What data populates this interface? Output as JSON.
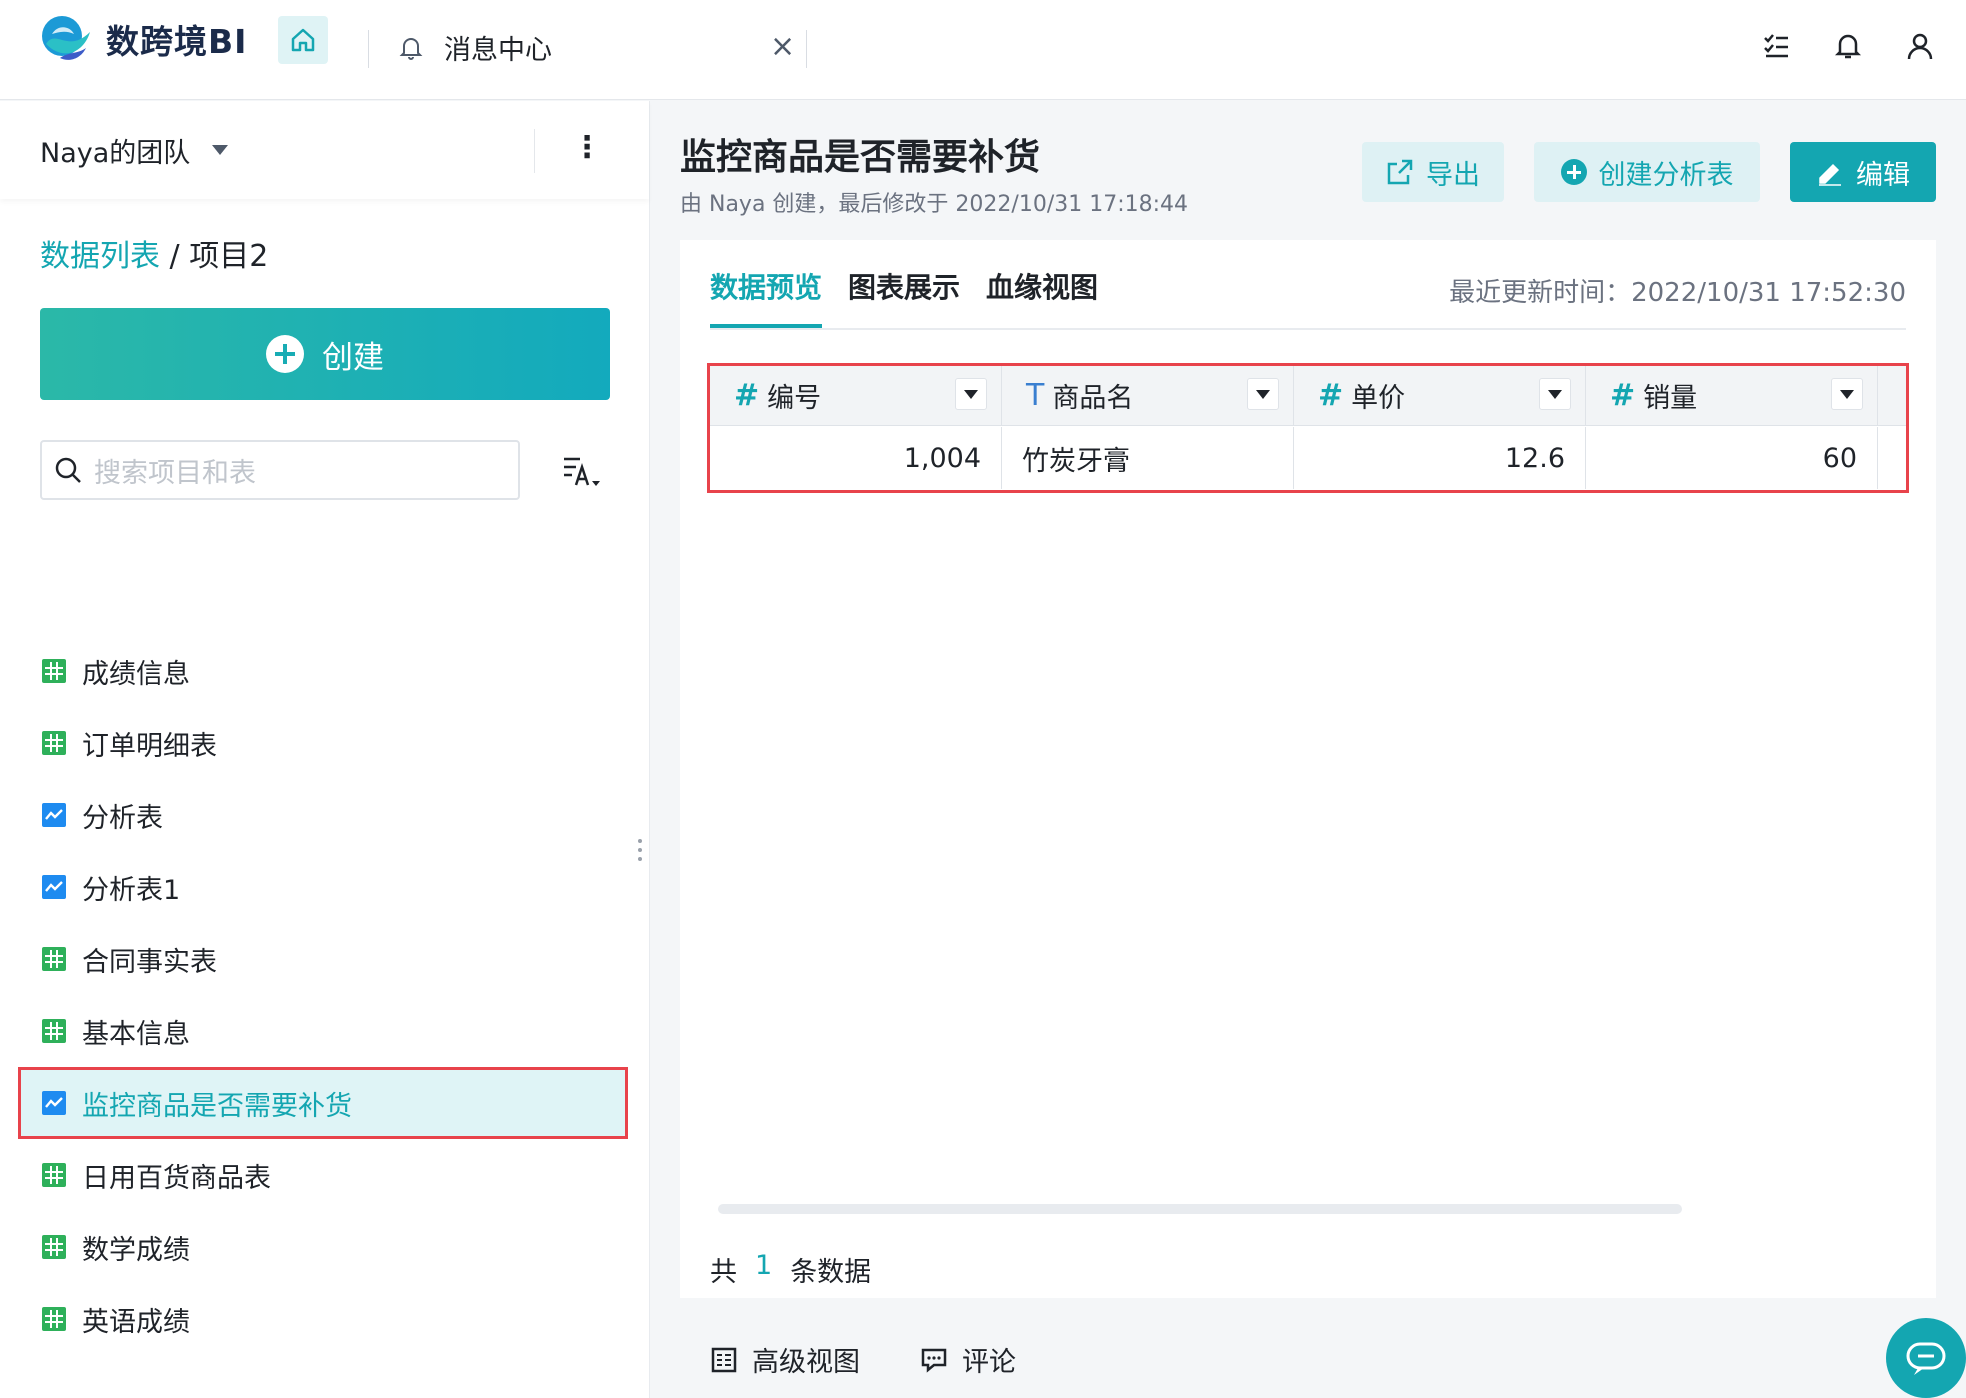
{
  "brand": {
    "name": "数跨境BI"
  },
  "top_tabs": {
    "message_tab": "消息中心",
    "close": "×"
  },
  "top_icons": [
    "tasks-icon",
    "bell-icon",
    "user-icon"
  ],
  "sidebar": {
    "team": "Naya的团队",
    "breadcrumb": {
      "link": "数据列表",
      "separator": "/",
      "current": "项目2"
    },
    "create_label": "创建",
    "search_placeholder": "搜索项目和表",
    "items": [
      {
        "label": "成绩信息",
        "icon": "table-icon"
      },
      {
        "label": "订单明细表",
        "icon": "table-icon"
      },
      {
        "label": "分析表",
        "icon": "chart-icon"
      },
      {
        "label": "分析表1",
        "icon": "chart-icon"
      },
      {
        "label": "合同事实表",
        "icon": "table-icon"
      },
      {
        "label": "基本信息",
        "icon": "table-icon"
      },
      {
        "label": "监控商品是否需要补货",
        "icon": "chart-icon",
        "active": true
      },
      {
        "label": "日用百货商品表",
        "icon": "table-icon"
      },
      {
        "label": "数学成绩",
        "icon": "table-icon"
      },
      {
        "label": "英语成绩",
        "icon": "table-icon"
      }
    ]
  },
  "main": {
    "title": "监控商品是否需要补货",
    "subtitle": "由 Naya 创建，最后修改于 2022/10/31 17:18:44",
    "buttons": {
      "export": "导出",
      "create_analysis": "创建分析表",
      "edit": "编辑"
    },
    "tabs": [
      "数据预览",
      "图表展示",
      "血缘视图"
    ],
    "active_tab": "数据预览",
    "update_time": "最近更新时间：2022/10/31 17:52:30",
    "columns": [
      {
        "type": "#",
        "name": "编号"
      },
      {
        "type": "T",
        "name": "商品名"
      },
      {
        "type": "#",
        "name": "单价"
      },
      {
        "type": "#",
        "name": "销量"
      }
    ],
    "rows": [
      [
        "1,004",
        "竹炭牙膏",
        "12.6",
        "60"
      ]
    ],
    "count": {
      "prefix": "共",
      "value": "1",
      "suffix": "条数据"
    },
    "bottom": {
      "advanced_view": "高级视图",
      "comments": "评论"
    }
  },
  "colors": {
    "accent": "#14a6b1",
    "highlight": "#e8434b",
    "table_icon": "#2eb05a",
    "chart_icon": "#1e8bf0"
  }
}
